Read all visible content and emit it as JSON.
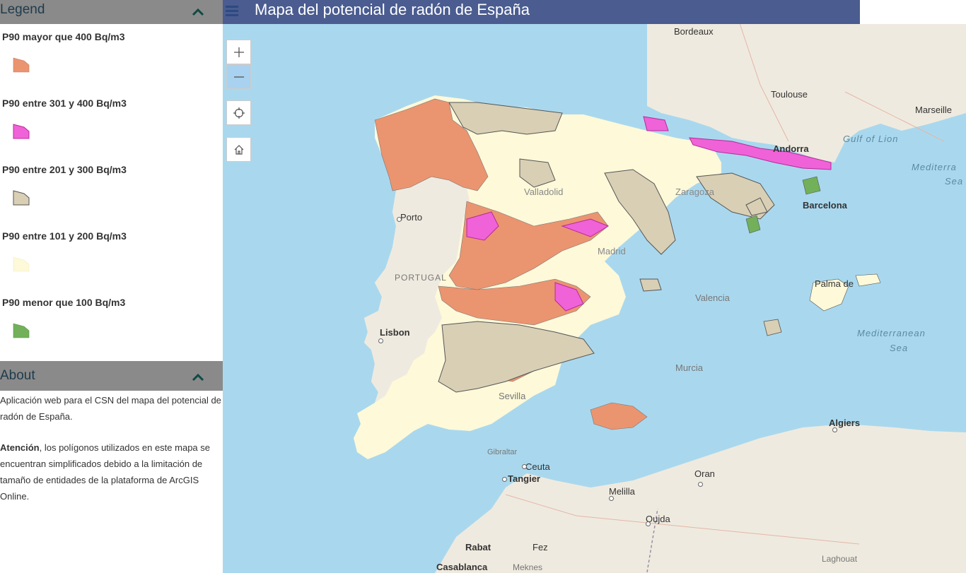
{
  "header": {
    "title": "Mapa del potencial de radón de España"
  },
  "legend": {
    "title": "Legend",
    "items": [
      {
        "label": "P90 mayor que 400 Bq/m3",
        "color": "#eb9470"
      },
      {
        "label": "P90 entre 301 y 400 Bq/m3",
        "color": "#f062d7"
      },
      {
        "label": "P90 entre 201 y 300 Bq/m3",
        "color": "#d9cfb5"
      },
      {
        "label": "P90 entre 101 y 200 Bq/m3",
        "color": "#fdf9d9"
      },
      {
        "label": "P90 menor que 100 Bq/m3",
        "color": "#72b05a"
      }
    ]
  },
  "about": {
    "title": "About",
    "p1": "Aplicación web para el CSN del mapa del potencial de radón de España.",
    "p2_bold": "Atención",
    "p2_rest": ", los polígonos utilizados en este mapa se encuentran simplificados debido a la limitación de tamaño de entidades de la plataforma de ArcGIS Online."
  },
  "map": {
    "labels": {
      "bordeaux": "Bordeaux",
      "toulouse": "Toulouse",
      "marseille": "Marseille",
      "gulf_of_lion": "Gulf of Lion",
      "andorra": "Andorra",
      "barcelona": "Barcelona",
      "porto": "Porto",
      "portugal": "PORTUGAL",
      "lisbon": "Lisbon",
      "palma": "Palma de",
      "mediterranean_sea_1": "Mediterranean",
      "mediterranean_sea_2": "Sea",
      "mediterra_right_1": "Mediterra",
      "mediterra_right_2": "Sea",
      "murcia": "Murcia",
      "sevilla": "Sevilla",
      "algiers": "Algiers",
      "ceuta": "Ceuta",
      "tangier": "Tangier",
      "oran": "Oran",
      "melilla": "Melilla",
      "oujda": "Oujda",
      "rabat": "Rabat",
      "fez": "Fez",
      "casablanca": "Casablanca",
      "meknes": "Meknes",
      "laghouat": "Laghouat",
      "gibraltar": "Gibraltar",
      "valencia": "Valencia",
      "valladolid": "Valladolid",
      "madrid": "Madrid",
      "zaragoza": "Zaragoza"
    },
    "colors": {
      "water": "#a9d8ee",
      "land": "#efeadf",
      "header": "#4a5c90"
    }
  }
}
